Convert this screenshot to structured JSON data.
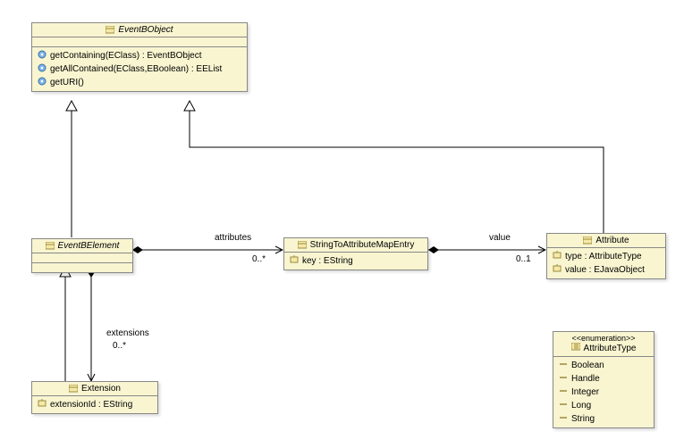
{
  "eventBObject": {
    "name": "EventBObject",
    "ops": [
      "getContaining(EClass) : EventBObject",
      "getAllContained(EClass,EBoolean) : EEList",
      "getURI()"
    ]
  },
  "eventBElement": {
    "name": "EventBElement"
  },
  "extension": {
    "name": "Extension",
    "attr": "extensionId : EString"
  },
  "stringToAttr": {
    "name": "StringToAttributeMapEntry",
    "attr": "key : EString"
  },
  "attribute": {
    "name": "Attribute",
    "attrs": [
      "type : AttributeType",
      "value : EJavaObject"
    ]
  },
  "attributeType": {
    "stereotype": "<<enumeration>>",
    "name": "AttributeType",
    "literals": [
      "Boolean",
      "Handle",
      "Integer",
      "Long",
      "String"
    ]
  },
  "edges": {
    "attributes": {
      "label": "attributes",
      "card": "0..*"
    },
    "value": {
      "label": "value",
      "card": "0..1"
    },
    "extensions": {
      "label": "extensions",
      "card": "0..*"
    }
  }
}
